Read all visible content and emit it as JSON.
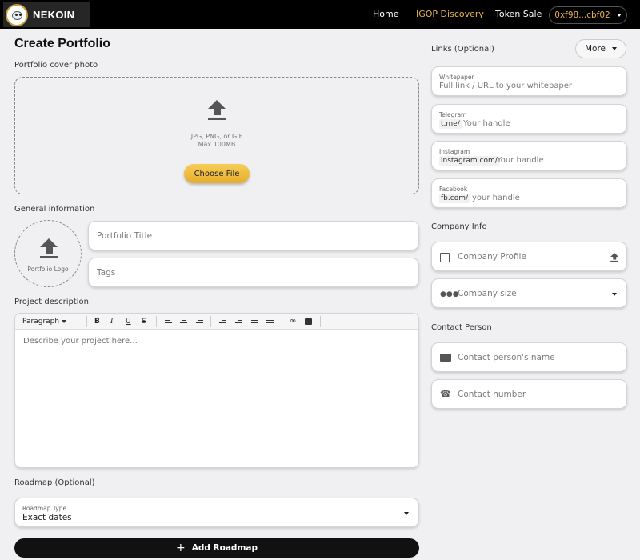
{
  "nav": {
    "brand": "NEKOIN",
    "links": [
      "Home",
      "IGOP Discovery",
      "Token Sale"
    ],
    "active_link": "IGOP Discovery",
    "wallet": "0xf98...cbf02",
    "accent_color": "#e8b54a"
  },
  "page": {
    "title": "Create Portfolio"
  },
  "cover": {
    "label": "Portfolio cover photo",
    "formats": "JPG, PNG, or GIF",
    "max_size": "Max 100MB",
    "choose_button": "Choose File"
  },
  "general": {
    "label": "General information",
    "logo_label": "Portfolio Logo",
    "title_placeholder": "Portfolio Title",
    "tags_placeholder": "Tags"
  },
  "description": {
    "label": "Project description",
    "toolbar": {
      "format": "Paragraph",
      "bold": "B",
      "italic": "I",
      "underline": "U",
      "strike": "S"
    },
    "placeholder": "Describe your project here..."
  },
  "roadmap": {
    "label": "Roadmap (Optional)",
    "type_label": "Roadmap Type",
    "type_value": "Exact dates",
    "add_button": "Add Roadmap"
  },
  "links": {
    "label": "Links (Optional)",
    "more_button": "More",
    "whitepaper": {
      "label": "Whitepaper",
      "placeholder": "Full link / URL to your whitepaper"
    },
    "telegram": {
      "label": "Telegram",
      "prefix": "t.me/",
      "placeholder": "Your handle"
    },
    "instagram": {
      "label": "Instagram",
      "prefix": "instagram.com/",
      "placeholder": "Your handle"
    },
    "facebook": {
      "label": "Facebook",
      "prefix": "fb.com/",
      "placeholder": "your handle"
    }
  },
  "company": {
    "label": "Company Info",
    "profile_placeholder": "Company Profile",
    "size_placeholder": "Company size"
  },
  "contact": {
    "label": "Contact Person",
    "name_placeholder": "Contact person's name",
    "number_placeholder": "Contact number"
  }
}
